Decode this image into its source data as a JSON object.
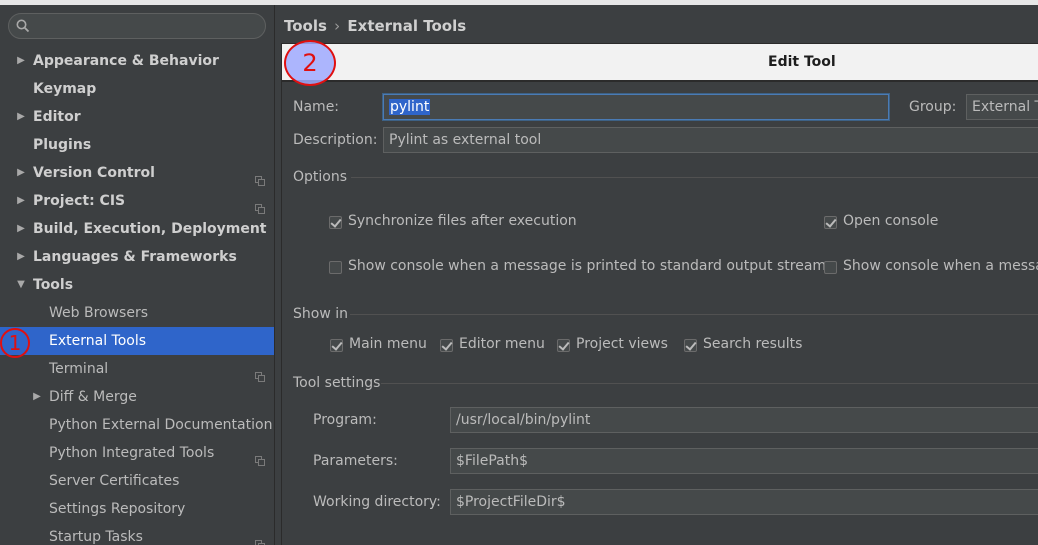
{
  "sidebar": {
    "search": {
      "placeholder": "",
      "icon": "search-icon"
    },
    "items": [
      {
        "label": "Appearance & Behavior",
        "expandable": true,
        "expanded": false,
        "bold": true,
        "level": 0,
        "project": false
      },
      {
        "label": "Keymap",
        "expandable": false,
        "bold": true,
        "level": 0,
        "project": false
      },
      {
        "label": "Editor",
        "expandable": true,
        "expanded": false,
        "bold": true,
        "level": 0,
        "project": false
      },
      {
        "label": "Plugins",
        "expandable": false,
        "bold": true,
        "level": 0,
        "project": false
      },
      {
        "label": "Version Control",
        "expandable": true,
        "expanded": false,
        "bold": true,
        "level": 0,
        "project": true
      },
      {
        "label": "Project: CIS",
        "expandable": true,
        "expanded": false,
        "bold": true,
        "level": 0,
        "project": true
      },
      {
        "label": "Build, Execution, Deployment",
        "expandable": true,
        "expanded": false,
        "bold": true,
        "level": 0,
        "project": false
      },
      {
        "label": "Languages & Frameworks",
        "expandable": true,
        "expanded": false,
        "bold": true,
        "level": 0,
        "project": false
      },
      {
        "label": "Tools",
        "expandable": true,
        "expanded": true,
        "bold": true,
        "level": 0,
        "project": false
      },
      {
        "label": "Web Browsers",
        "expandable": false,
        "bold": false,
        "level": 1,
        "project": false
      },
      {
        "label": "External Tools",
        "expandable": false,
        "bold": false,
        "level": 1,
        "project": false,
        "selected": true
      },
      {
        "label": "Terminal",
        "expandable": false,
        "bold": false,
        "level": 1,
        "project": true
      },
      {
        "label": "Diff & Merge",
        "expandable": true,
        "expanded": false,
        "bold": false,
        "level": 1,
        "project": false
      },
      {
        "label": "Python External Documentation",
        "expandable": false,
        "bold": false,
        "level": 1,
        "project": false
      },
      {
        "label": "Python Integrated Tools",
        "expandable": false,
        "bold": false,
        "level": 1,
        "project": true
      },
      {
        "label": "Server Certificates",
        "expandable": false,
        "bold": false,
        "level": 1,
        "project": false
      },
      {
        "label": "Settings Repository",
        "expandable": false,
        "bold": false,
        "level": 1,
        "project": false
      },
      {
        "label": "Startup Tasks",
        "expandable": false,
        "bold": false,
        "level": 1,
        "project": true
      }
    ]
  },
  "markers": {
    "one": "1",
    "two": "2"
  },
  "breadcrumb": {
    "parent": "Tools",
    "separator": "›",
    "current": "External Tools"
  },
  "dialog": {
    "title": "Edit Tool",
    "name_label": "Name:",
    "name_value": "pylint",
    "group_label": "Group:",
    "group_value": "External Tools",
    "description_label": "Description:",
    "description_value": "Pylint as external tool",
    "options_section": "Options",
    "options": {
      "sync_files": {
        "label": "Synchronize files after execution",
        "checked": true
      },
      "open_console": {
        "label": "Open console",
        "checked": true
      },
      "show_console_stdout": {
        "label": "Show console when a message is printed to standard output stream",
        "checked": false
      },
      "show_console_stderr": {
        "label": "Show console when a message is printed to standard error stream",
        "checked": false
      }
    },
    "show_in_section": "Show in",
    "show_in": {
      "main_menu": {
        "label": "Main menu",
        "checked": true
      },
      "editor_menu": {
        "label": "Editor menu",
        "checked": true
      },
      "project_views": {
        "label": "Project views",
        "checked": true
      },
      "search_results": {
        "label": "Search results",
        "checked": true
      }
    },
    "tool_settings_section": "Tool settings",
    "program_label": "Program:",
    "program_value": "/usr/local/bin/pylint",
    "parameters_label": "Parameters:",
    "parameters_value": "$FilePath$",
    "working_dir_label": "Working directory:",
    "working_dir_value": "$ProjectFileDir$"
  },
  "colors": {
    "selection": "#2f65ca",
    "background": "#3c3f41",
    "marker": "#e01010"
  }
}
